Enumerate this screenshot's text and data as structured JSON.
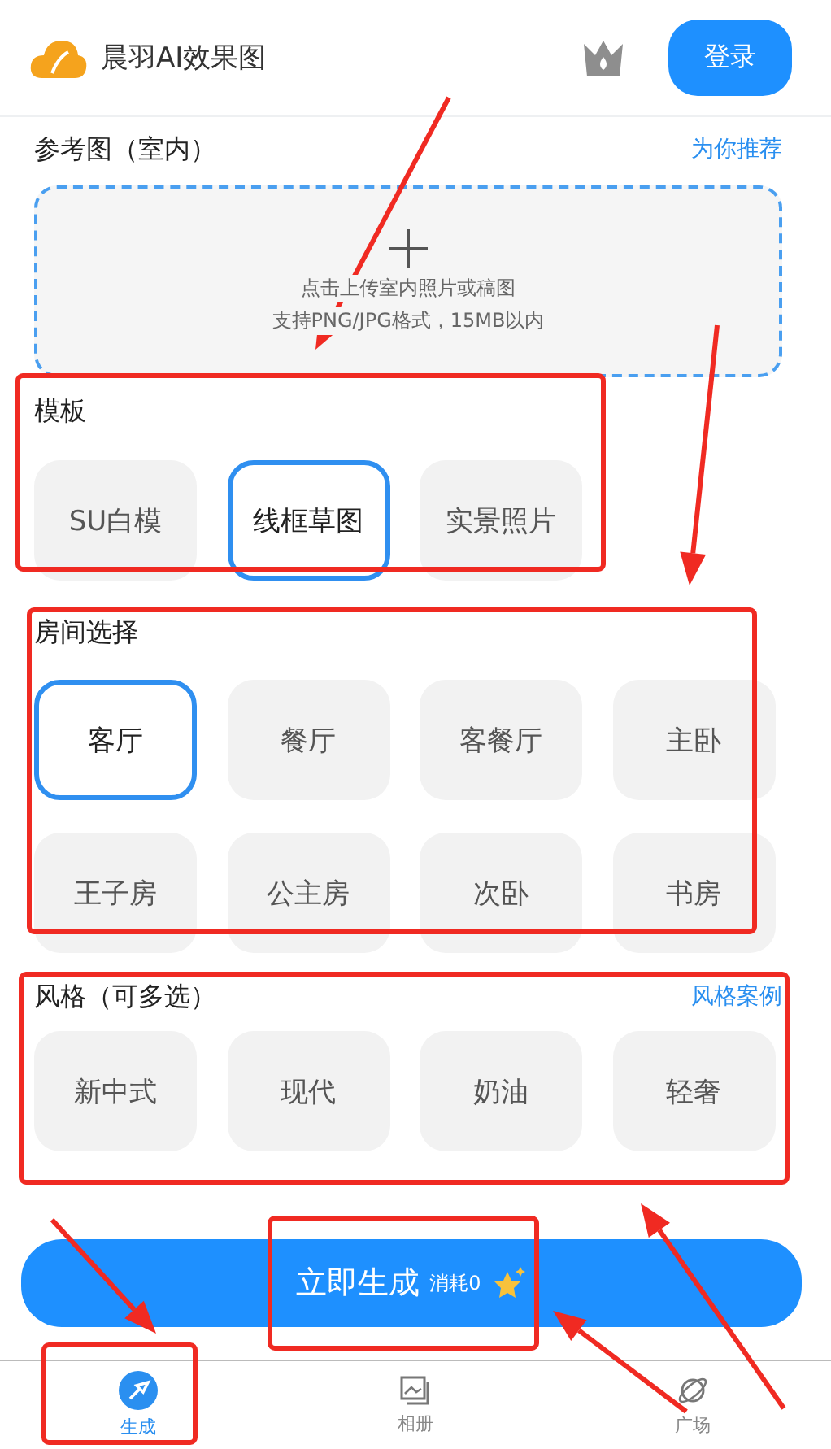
{
  "header": {
    "app_name": "晨羽AI效果图",
    "login": "登录"
  },
  "reference": {
    "title": "参考图（室内）",
    "link": "为你推荐",
    "upload_hint": "点击上传室内照片或稿图",
    "upload_formats": "支持PNG/JPG格式，15MB以内"
  },
  "template": {
    "title": "模板",
    "options": [
      {
        "label": "SU白模",
        "selected": false
      },
      {
        "label": "线框草图",
        "selected": true
      },
      {
        "label": "实景照片",
        "selected": false
      }
    ]
  },
  "room": {
    "title": "房间选择",
    "options": [
      {
        "label": "客厅",
        "selected": true
      },
      {
        "label": "餐厅",
        "selected": false
      },
      {
        "label": "客餐厅",
        "selected": false
      },
      {
        "label": "主卧",
        "selected": false
      },
      {
        "label": "王子房",
        "selected": false
      },
      {
        "label": "公主房",
        "selected": false
      },
      {
        "label": "次卧",
        "selected": false
      },
      {
        "label": "书房",
        "selected": false
      }
    ]
  },
  "style": {
    "title": "风格（可多选）",
    "link": "风格案例",
    "options": [
      {
        "label": "新中式",
        "selected": false
      },
      {
        "label": "现代",
        "selected": false
      },
      {
        "label": "奶油",
        "selected": false
      },
      {
        "label": "轻奢",
        "selected": false
      }
    ]
  },
  "generate": {
    "label": "立即生成",
    "cost": "消耗0"
  },
  "tabs": [
    {
      "label": "生成",
      "selected": true
    },
    {
      "label": "相册",
      "selected": false
    },
    {
      "label": "广场",
      "selected": false
    }
  ]
}
